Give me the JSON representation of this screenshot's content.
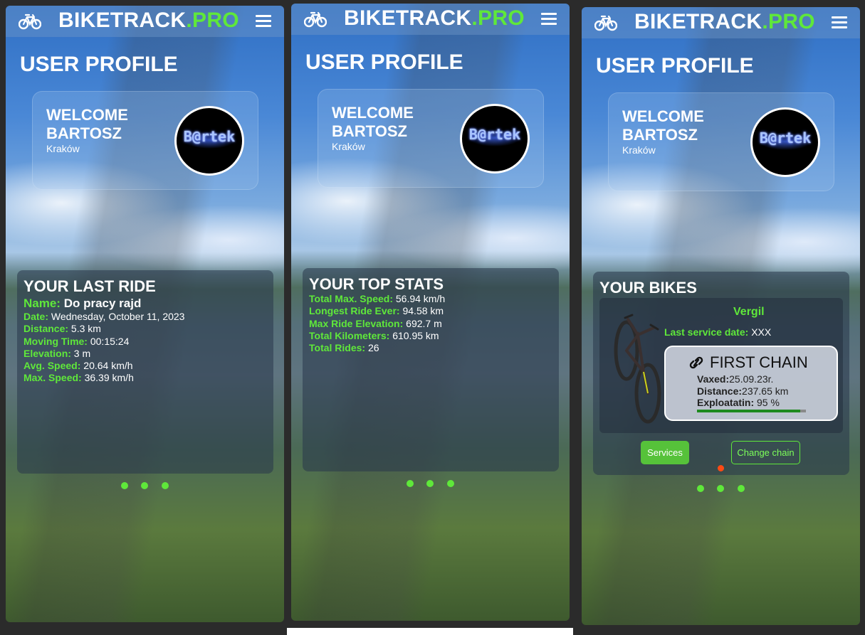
{
  "app": {
    "brand_main": "BIKETRACK",
    "brand_accent": ".PRO",
    "accent_color": "#5fe83a",
    "icons": [
      "bicycle-icon",
      "hamburger-menu-icon",
      "link-icon"
    ]
  },
  "screens": [
    {
      "page_title": "USER PROFILE",
      "welcome": {
        "line1": "WELCOME",
        "line2": "BARTOSZ",
        "city": "Kraków",
        "avatar_text": "B@rtek"
      },
      "panel": {
        "title": "YOUR LAST RIDE",
        "rows": [
          {
            "key": "Name:",
            "value": "Do pracy rajd"
          },
          {
            "key": "Date:",
            "value": "Wednesday, October 11, 2023"
          },
          {
            "key": "Distance:",
            "value": "5.3 km"
          },
          {
            "key": "Moving Time:",
            "value": "00:15:24"
          },
          {
            "key": "Elevation:",
            "value": "3 m"
          },
          {
            "key": "Avg. Speed:",
            "value": "20.64 km/h"
          },
          {
            "key": "Max. Speed:",
            "value": "36.39 km/h"
          }
        ]
      }
    },
    {
      "page_title": "USER PROFILE",
      "welcome": {
        "line1": "WELCOME",
        "line2": "BARTOSZ",
        "city": "Kraków",
        "avatar_text": "B@rtek"
      },
      "panel": {
        "title": "YOUR TOP STATS",
        "rows": [
          {
            "key": "Total Max. Speed:",
            "value": "56.94 km/h"
          },
          {
            "key": "Longest Ride Ever:",
            "value": "94.58 km"
          },
          {
            "key": "Max Ride Elevation:",
            "value": "692.7 m"
          },
          {
            "key": "Total Kilometers:",
            "value": "610.95 km"
          },
          {
            "key": "Total Rides:",
            "value": "26"
          }
        ]
      }
    },
    {
      "page_title": "USER PROFILE",
      "welcome": {
        "line1": "WELCOME",
        "line2": "BARTOSZ",
        "city": "Kraków",
        "avatar_text": "B@rtek"
      },
      "panel": {
        "title": "YOUR BIKES",
        "bike": {
          "name": "Vergil",
          "service_key": "Last service date:",
          "service_value": "XXX",
          "chain": {
            "title": "FIRST CHAIN",
            "rows": [
              {
                "key": "Vaxed:",
                "value": "25.09.23r."
              },
              {
                "key": "Distance:",
                "value": "237.65 km"
              },
              {
                "key": "Exploatatin:",
                "value": "95 %"
              }
            ],
            "wear_fraction": 0.95
          }
        },
        "services_label": "Services",
        "change_chain_label": "Change chain"
      }
    }
  ]
}
